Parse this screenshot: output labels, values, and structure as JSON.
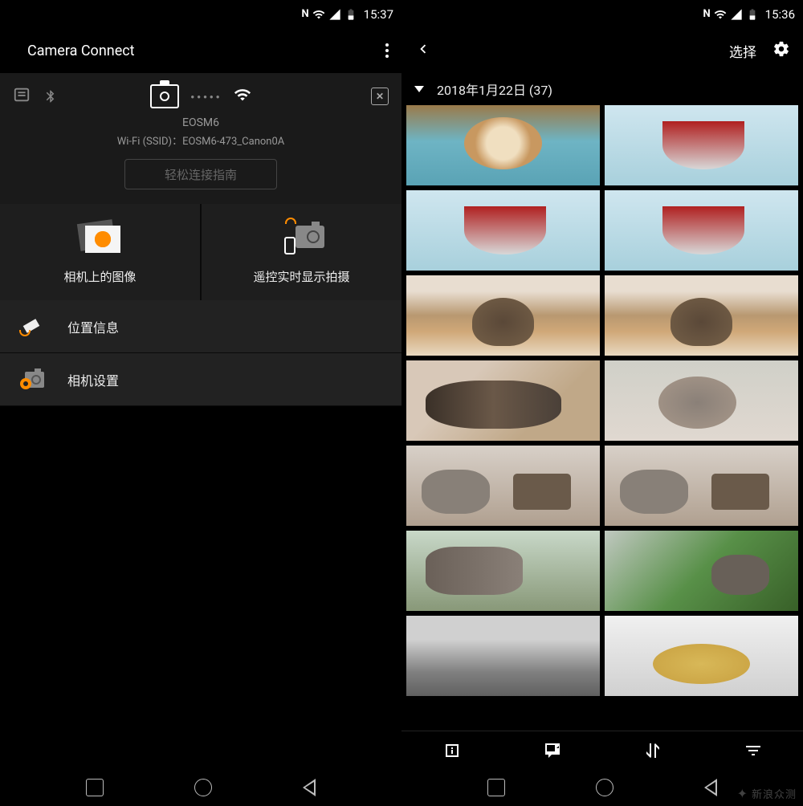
{
  "left": {
    "status_time": "15:37",
    "app_title": "Camera Connect",
    "camera_name": "EOSM6",
    "ssid_label": "Wi-Fi (SSID)：",
    "ssid_value": "EOSM6-473_Canon0A",
    "guide_button": "轻松连接指南",
    "tile_images": "相机上的图像",
    "tile_remote": "遥控实时显示拍摄",
    "item_location": "位置信息",
    "item_settings": "相机设置"
  },
  "right": {
    "status_time": "15:36",
    "select_label": "选择",
    "date": "2018年1月22日",
    "count": "(37)"
  },
  "watermark": "新浪众测"
}
